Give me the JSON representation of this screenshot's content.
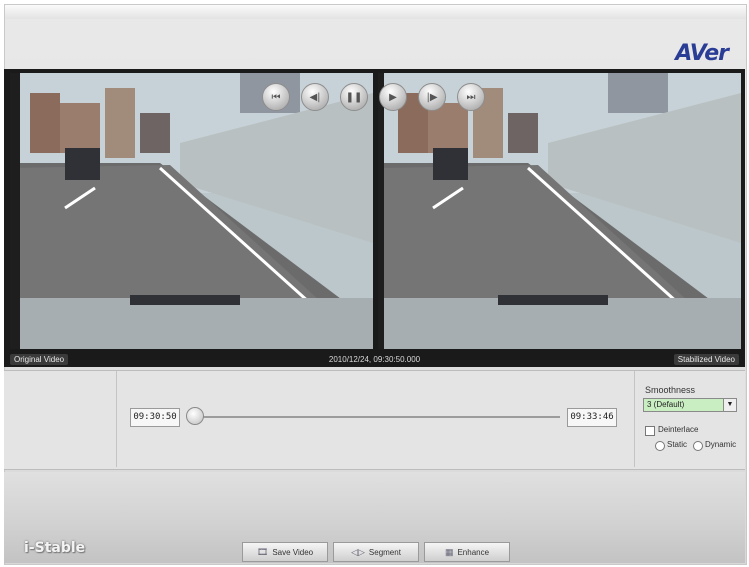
{
  "brand": {
    "logo": "AVer",
    "product": "i-Stable"
  },
  "video": {
    "left_label": "Original Video",
    "right_label": "Stabilized Video",
    "timestamp": "2010/12/24, 09:30:50.000"
  },
  "timeline": {
    "start_time": "09:30:50",
    "end_time": "09:33:46"
  },
  "playback": {
    "buttons": [
      {
        "name": "first",
        "icon": "skip-to-start-icon"
      },
      {
        "name": "prev-frame",
        "icon": "step-back-icon"
      },
      {
        "name": "pause",
        "icon": "pause-icon"
      },
      {
        "name": "play",
        "icon": "play-icon"
      },
      {
        "name": "next-frame",
        "icon": "step-forward-icon"
      },
      {
        "name": "last",
        "icon": "skip-to-end-icon"
      }
    ]
  },
  "settings": {
    "smoothness_label": "Smoothness",
    "smoothness_value": "3 (Default)",
    "deinterlace_label": "Deinterlace",
    "static_label": "Static",
    "dynamic_label": "Dynamic"
  },
  "toolbar": {
    "save_label": "Save Video",
    "segment_label": "Segment",
    "enhance_label": "Enhance"
  },
  "colors": {
    "logo_blue": "#2a3d96",
    "logo_red": "#c1272d",
    "select_bg": "#c9eec2"
  }
}
